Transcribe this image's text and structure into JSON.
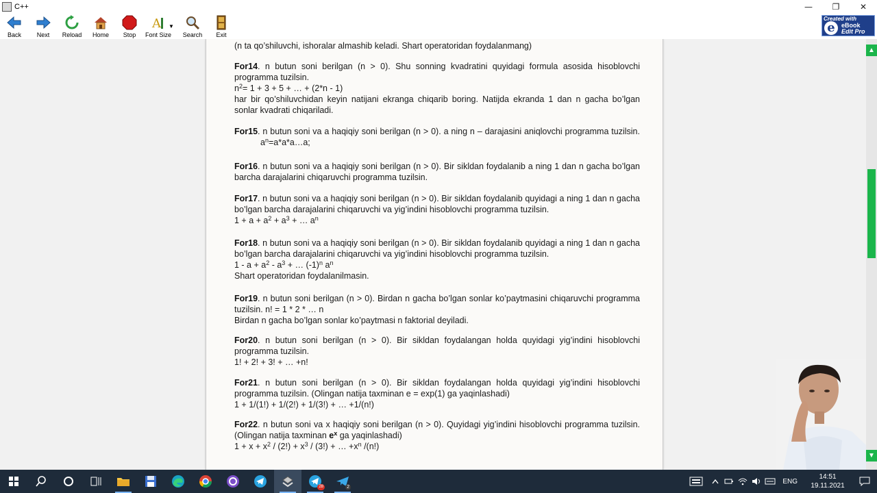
{
  "window": {
    "title": "C++",
    "controls": [
      "—",
      "❐",
      "✕"
    ]
  },
  "toolbar": {
    "buttons": [
      {
        "id": "back",
        "label": "Back",
        "icon": "back-arrow-icon"
      },
      {
        "id": "next",
        "label": "Next",
        "icon": "forward-arrow-icon"
      },
      {
        "id": "reload",
        "label": "Reload",
        "icon": "reload-icon"
      },
      {
        "id": "home",
        "label": "Home",
        "icon": "home-icon"
      },
      {
        "id": "stop",
        "label": "Stop",
        "icon": "stop-icon"
      },
      {
        "id": "fontsize",
        "label": "Font Size",
        "icon": "font-size-icon"
      },
      {
        "id": "search",
        "label": "Search",
        "icon": "search-icon"
      },
      {
        "id": "exit",
        "label": "Exit",
        "icon": "exit-door-icon"
      }
    ],
    "badge": {
      "line1": "Created with",
      "letter": "e",
      "line2": "eBook",
      "line3": "Edit Pro"
    }
  },
  "content": {
    "intro": "(n ta qo’shiluvchi, ishoralar almashib keladi. Shart operatoridan foydalanmang)",
    "for14": {
      "title": "For14",
      "text1": ". n butun soni berilgan (n > 0). Shu sonning kvadratini quyidagi formula asosida hisoblovchi programma tuzilsin.",
      "formula_a": "n",
      "formula_sup": "2",
      "formula_b": "= 1 + 3 + 5 + … + (2*n  - 1)",
      "text2": "har bir qo’shiluvchidan keyin natijani ekranga chiqarib boring. Natijda ekranda 1 dan n gacha bo’lgan sonlar kvadrati chiqariladi."
    },
    "for15": {
      "title": "For15",
      "text1": ". n butun soni va a haqiqiy soni berilgan (n > 0). a ning n – darajasini aniqlovchi programma tuzilsin.",
      "formula_a": "a",
      "formula_sup": "n",
      "formula_b": "=a*a*a…a;"
    },
    "for16": {
      "title": "For16",
      "text1": ". n butun soni va a haqiqiy soni berilgan (n > 0). Bir sikldan foydalanib a ning 1 dan n gacha bo’lgan barcha  darajalarini chiqaruvchi programma tuzilsin."
    },
    "for17": {
      "title": "For17",
      "text1": ". n butun soni va a haqiqiy soni berilgan (n > 0). Bir sikldan foydalanib quyidagi a ning 1 dan n gacha bo’lgan barcha  darajalarini chiqaruvchi va yig’indini hisoblovchi programma tuzilsin.",
      "f1": "1 + a + a",
      "s1": "2",
      "f2": " + a",
      "s2": "3",
      "f3": " + … a",
      "s3": "n"
    },
    "for18": {
      "title": "For18",
      "text1": ". n butun soni va a haqiqiy soni berilgan (n > 0). Bir sikldan foydalanib quyidagi a ning 1 dan n gacha bo’lgan barcha  darajalarini chiqaruvchi va yig’indini hisoblovchi programma tuzilsin.",
      "f1": "1 - a + a",
      "s1": "2",
      "f2": " - a",
      "s2": "3",
      "f3": " + … (-1)",
      "s3": "n",
      "f4": " a",
      "s4": "n",
      "text2": "Shart operatoridan foydalanilmasin."
    },
    "for19": {
      "title": "For19",
      "text1": ". n butun soni berilgan (n > 0). Birdan n gacha bo’lgan sonlar ko’paytmasini chiqaruvchi programma tuzilsin.  n! = 1 * 2 * … n",
      "text2": "Birdan n gacha bo’lgan sonlar ko’paytmasi n faktorial deyiladi."
    },
    "for20": {
      "title": "For20",
      "text1": ". n butun soni berilgan (n > 0). Bir sikldan foydalangan holda quyidagi yig’indini hisoblovchi programma tuzilsin.",
      "formula": "1! + 2! + 3! + … +n!"
    },
    "for21": {
      "title": "For21",
      "text1": ". n butun soni berilgan (n > 0). Bir sikldan foydalangan holda quyidagi yig’indini hisoblovchi programma tuzilsin. (Olingan natija taxminan e = exp(1) ga yaqinlashadi)",
      "formula": "1 + 1/(1!) + 1/(2!) + 1/(3!) + … +1/(n!)"
    },
    "for22": {
      "title": "For22",
      "text1": ". n butun soni va x haqiqiy soni berilgan (n > 0). Quyidagi yig’indini hisoblovchi programma tuzilsin. (Olingan natija taxminan ",
      "bold_e": "e",
      "bold_sup": "x",
      "text1b": " ga yaqinlashadi)",
      "f1": "1 + x + x",
      "s1": "2",
      "f2": " / (2!) + x",
      "s2": "3",
      "f3": " / (3!) + … +x",
      "s3": "n",
      "f4": " /(n!)"
    }
  },
  "taskbar": {
    "apps": [
      "windows-start-icon",
      "search-icon",
      "cortana-circle-icon",
      "task-view-icon",
      "file-explorer-icon",
      "save-floppy-icon",
      "edge-browser-icon",
      "chrome-browser-icon",
      "github-desktop-icon",
      "telegram-icon",
      "ebook-app-icon",
      "telegram-icon",
      "telegram-icon"
    ],
    "badge_28": "28",
    "badge_2": "2",
    "tray": {
      "lang": "ENG",
      "time": "14:51",
      "date": "19.11.2021"
    }
  },
  "colors": {
    "accent_green": "#1bb54b",
    "taskbar": "#1e2b3a",
    "page_bg": "#fbfaf8"
  }
}
